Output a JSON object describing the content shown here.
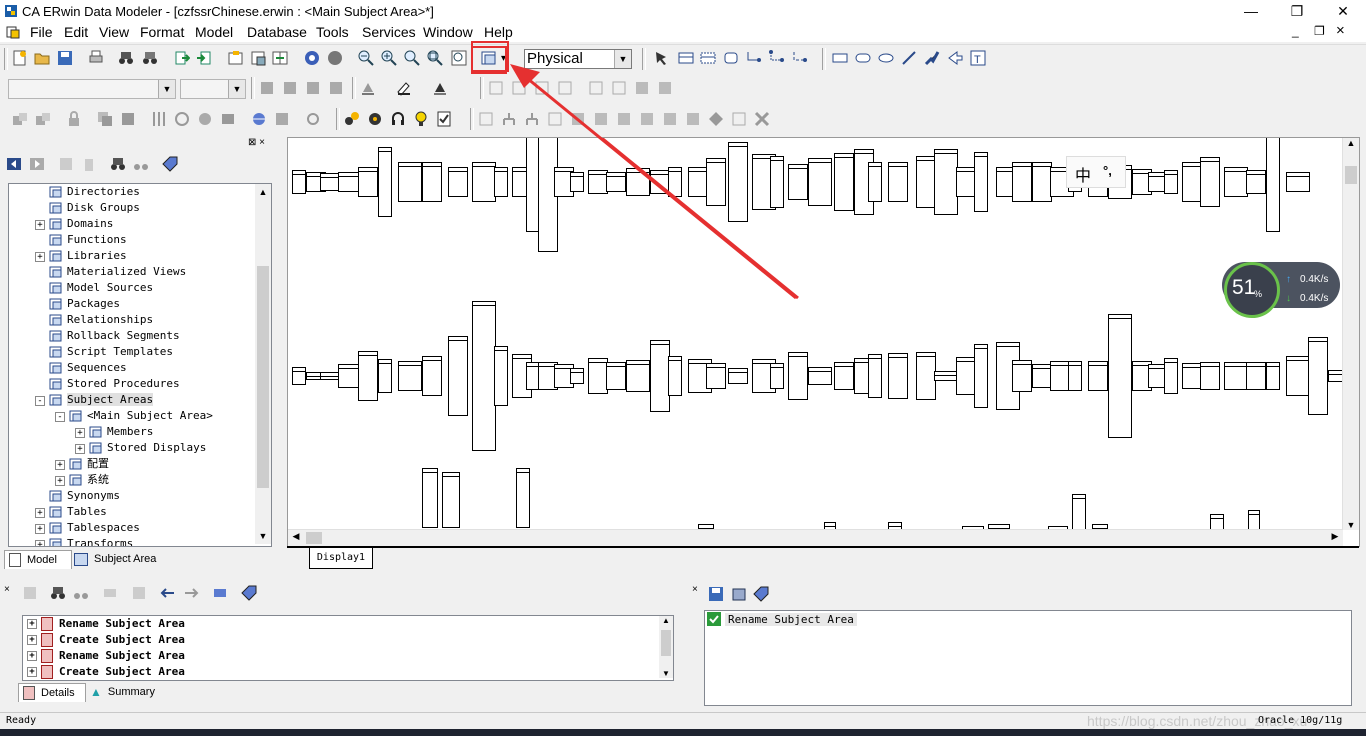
{
  "window": {
    "title": "CA ERwin Data Modeler - [czfssrChinese.erwin : <Main Subject Area>*]",
    "controls": [
      "—",
      "❐",
      "✕"
    ],
    "mdi_controls": [
      "_",
      "❐",
      "×"
    ]
  },
  "menubar": {
    "items": [
      "File",
      "Edit",
      "View",
      "Format",
      "Model",
      "Database",
      "Tools",
      "Services",
      "Window",
      "Help"
    ]
  },
  "toolbar": {
    "notation_select": "Physical"
  },
  "model_tree": {
    "items": [
      {
        "label": "Directories",
        "icon": "directory-icon"
      },
      {
        "label": "Disk Groups",
        "icon": "disk-group-icon"
      },
      {
        "label": "Domains",
        "icon": "domain-icon"
      },
      {
        "label": "Functions",
        "icon": "function-icon"
      },
      {
        "label": "Libraries",
        "icon": "library-icon"
      },
      {
        "label": "Materialized Views",
        "icon": "materialized-view-icon"
      },
      {
        "label": "Model Sources",
        "icon": "model-source-icon"
      },
      {
        "label": "Packages",
        "icon": "package-icon"
      },
      {
        "label": "Relationships",
        "icon": "relationship-icon"
      },
      {
        "label": "Rollback Segments",
        "icon": "rollback-icon"
      },
      {
        "label": "Script Templates",
        "icon": "script-icon"
      },
      {
        "label": "Sequences",
        "icon": "sequence-icon"
      },
      {
        "label": "Stored Procedures",
        "icon": "procedure-icon"
      },
      {
        "label": "Subject Areas",
        "icon": "subject-area-icon"
      },
      {
        "label": "<Main Subject Area>",
        "icon": "subject-area-icon"
      },
      {
        "label": "Members",
        "icon": "members-icon"
      },
      {
        "label": "Stored Displays",
        "icon": "display-icon"
      },
      {
        "label": "配置",
        "icon": "subject-area-icon"
      },
      {
        "label": "系统",
        "icon": "subject-area-icon"
      },
      {
        "label": "Synonyms",
        "icon": "synonym-icon"
      },
      {
        "label": "Tables",
        "icon": "table-icon"
      },
      {
        "label": "Tablespaces",
        "icon": "tablespace-icon"
      },
      {
        "label": "Transforms",
        "icon": "transform-icon"
      }
    ]
  },
  "left_tabs": [
    "Model",
    "Subject Area"
  ],
  "diagram": {
    "tab": "Display1",
    "ime": {
      "char": "中",
      "symbol": "°,"
    }
  },
  "net_widget": {
    "percent": "51",
    "percent_unit": "%",
    "up": "0.4K/s",
    "down": "0.4K/s"
  },
  "action_log": {
    "items": [
      "Rename Subject Area",
      "Create Subject Area",
      "Rename Subject Area",
      "Create Subject Area"
    ],
    "tabs": [
      "Details",
      "Summary"
    ]
  },
  "detail_pane": {
    "item": "Rename Subject Area"
  },
  "statusbar": {
    "status": "Ready",
    "target_db": "Oracle 10g/11g",
    "watermark": "https://blog.csdn.net/zhou_zhao_xu"
  }
}
